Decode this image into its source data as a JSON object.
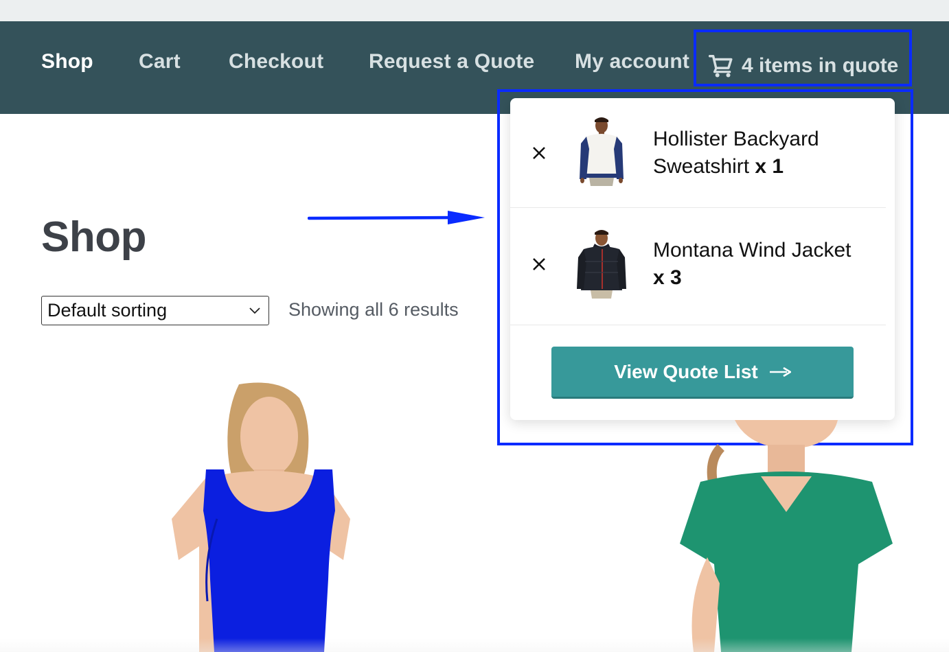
{
  "nav": {
    "items": [
      {
        "label": "Shop",
        "active": true
      },
      {
        "label": "Cart",
        "active": false
      },
      {
        "label": "Checkout",
        "active": false
      },
      {
        "label": "Request a Quote",
        "active": false
      },
      {
        "label": "My account",
        "active": false
      }
    ],
    "quote_toggle": {
      "icon": "cart-icon",
      "label": "4 items in quote"
    }
  },
  "main": {
    "title": "Shop",
    "sorting": {
      "selected": "Default sorting"
    },
    "result_count": "Showing all 6 results"
  },
  "quote_panel": {
    "items": [
      {
        "name": "Hollister Backyard Sweatshirt",
        "qty": "x 1",
        "remove_icon": "close-icon",
        "thumbnail": "sweatshirt-image"
      },
      {
        "name": "Montana Wind Jacket",
        "qty": "x 3",
        "remove_icon": "close-icon",
        "thumbnail": "jacket-image"
      }
    ],
    "button": {
      "label": "View Quote List",
      "icon": "arrow-right-icon"
    }
  },
  "products": [
    {
      "image": "blue-tank-top-image"
    },
    {
      "image": "green-tshirt-image"
    }
  ],
  "colors": {
    "navbar": "#34525a",
    "button": "#37999a",
    "annotation": "#0a2bff"
  }
}
